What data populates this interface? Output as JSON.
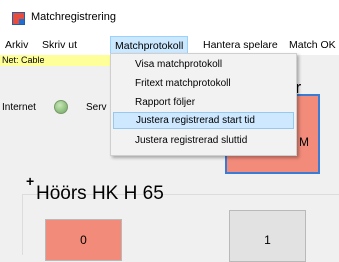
{
  "window": {
    "title": "Matchregistrering"
  },
  "menubar": {
    "items": [
      {
        "label": "Arkiv"
      },
      {
        "label": "Skriv ut"
      },
      {
        "label": "Matchprotokoll"
      },
      {
        "label": "Hantera spelare"
      },
      {
        "label": "Match OK"
      }
    ],
    "open_index": 2
  },
  "dropdown": {
    "items": [
      {
        "label": "Visa matchprotokoll"
      },
      {
        "label": "Fritext matchprotokoll"
      },
      {
        "label": "Rapport följer"
      },
      {
        "label": "Justera registrerad start tid"
      },
      {
        "label": "Justera registrerad sluttid"
      }
    ],
    "highlighted_index": 3
  },
  "status": {
    "net_label": "Net: Cable",
    "internet_label": "Internet",
    "internet_status_color": "#6da65a",
    "server_label_partial": "Serv"
  },
  "right_panel": {
    "heading_partial": "er",
    "box_letter": "M",
    "box_color": "#f28b7a"
  },
  "team": {
    "plus_label": "+",
    "name": "Höörs HK H 65",
    "home_score": "0",
    "away_score": "1"
  }
}
